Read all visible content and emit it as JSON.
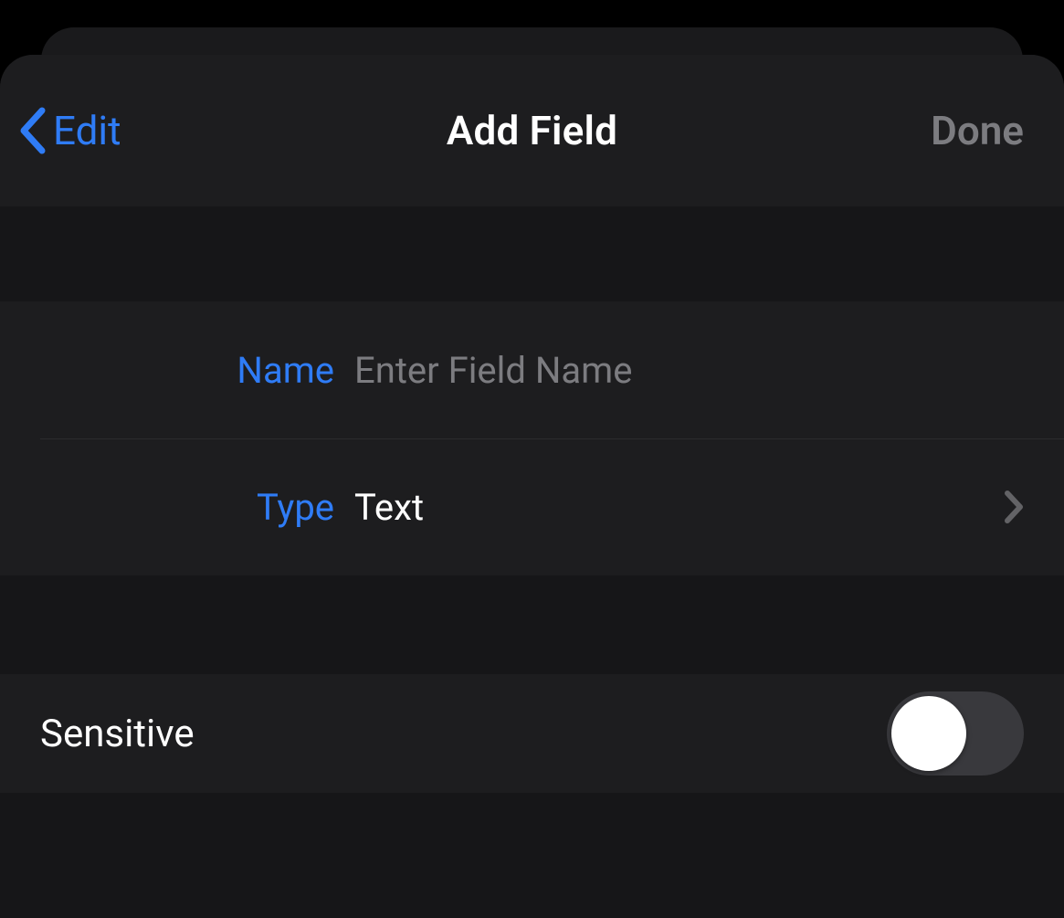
{
  "nav": {
    "back_label": "Edit",
    "title": "Add Field",
    "done_label": "Done"
  },
  "fields": {
    "name": {
      "label": "Name",
      "placeholder": "Enter Field Name",
      "value": ""
    },
    "type": {
      "label": "Type",
      "value": "Text"
    }
  },
  "sensitive": {
    "label": "Sensitive",
    "on": false
  }
}
